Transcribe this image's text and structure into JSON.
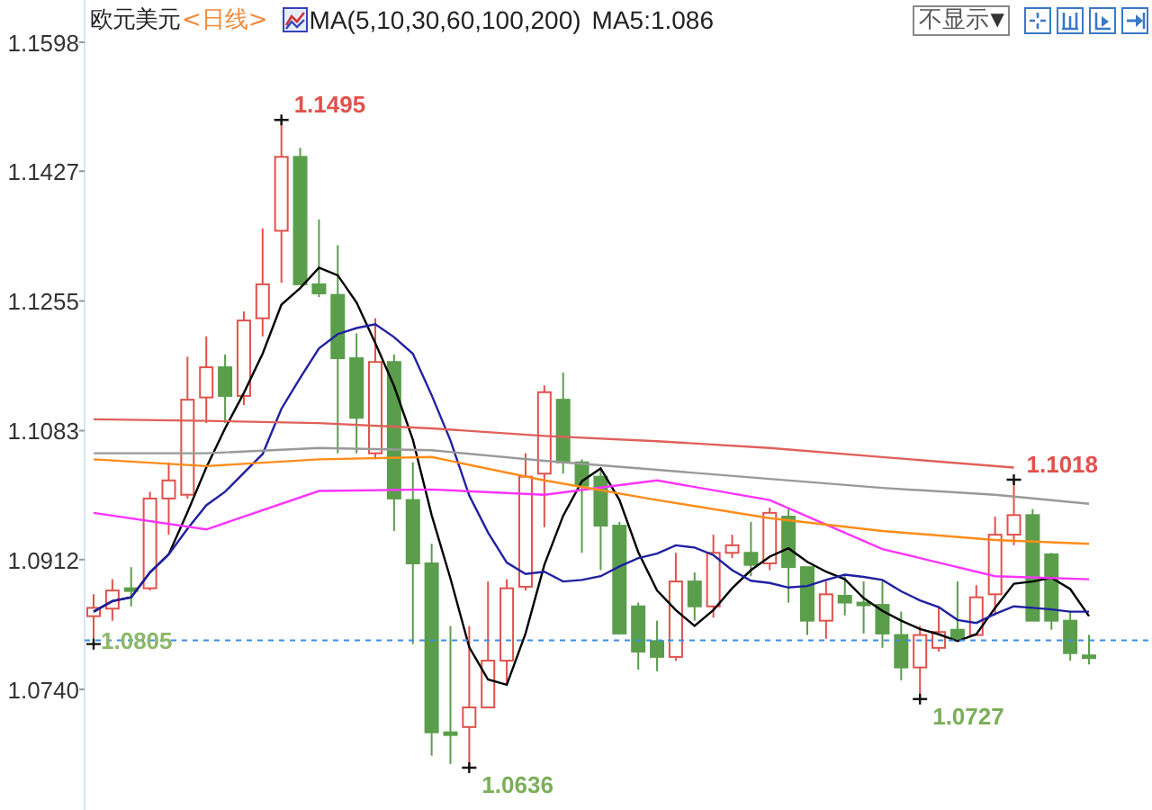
{
  "header": {
    "symbol": "欧元美元",
    "period": "<日线>",
    "indicator": "MA(5,10,30,60,100,200)",
    "indicator_value": "MA5:1.086",
    "dropdown": {
      "value": "不显示",
      "caret": "▼"
    }
  },
  "chart_data": {
    "type": "candlestick",
    "ylim": [
      1.058,
      1.1654
    ],
    "categories": [
      null,
      null,
      null,
      null,
      null,
      null,
      null,
      null,
      null,
      null,
      null,
      null,
      null,
      null,
      null,
      null,
      null,
      null,
      null,
      null,
      null,
      null,
      null,
      null,
      null,
      null,
      null,
      null,
      null,
      null,
      null,
      null,
      null,
      null,
      null,
      null,
      null,
      null,
      null,
      null,
      null,
      null,
      null,
      null,
      null,
      null,
      null,
      null,
      null,
      null,
      null,
      null,
      null,
      null
    ],
    "yticks": [
      {
        "value": 1.074,
        "label": "1.0740"
      },
      {
        "value": 1.0912,
        "label": "1.0912"
      },
      {
        "value": 1.1083,
        "label": "1.1083"
      },
      {
        "value": 1.1255,
        "label": "1.1255"
      },
      {
        "value": 1.1427,
        "label": "1.1427"
      },
      {
        "value": 1.1598,
        "label": "1.1598"
      }
    ],
    "ohlc": [
      [
        1.0837,
        1.0866,
        1.08,
        1.0848
      ],
      [
        1.0847,
        1.0886,
        1.0831,
        1.0871
      ],
      [
        1.0874,
        1.0902,
        1.085,
        1.0871
      ],
      [
        1.0874,
        1.1002,
        1.0871,
        1.0993
      ],
      [
        1.0993,
        1.1041,
        1.0945,
        1.1017
      ],
      [
        1.0998,
        1.1181,
        1.0993,
        1.1124
      ],
      [
        1.1127,
        1.1208,
        1.1093,
        1.1167
      ],
      [
        1.1167,
        1.1184,
        1.1093,
        1.1129
      ],
      [
        1.1129,
        1.1241,
        1.1117,
        1.1229
      ],
      [
        1.1232,
        1.1351,
        1.1208,
        1.1277
      ],
      [
        1.1348,
        1.1495,
        1.1279,
        1.1446
      ],
      [
        1.1446,
        1.1458,
        1.1277,
        1.1277
      ],
      [
        1.1277,
        1.1363,
        1.126,
        1.1265
      ],
      [
        1.1263,
        1.1329,
        1.1053,
        1.1179
      ],
      [
        1.1179,
        1.1212,
        1.1053,
        1.11
      ],
      [
        1.1053,
        1.1232,
        1.1045,
        1.1174
      ],
      [
        1.1174,
        1.1184,
        1.095,
        1.0993
      ],
      [
        1.0991,
        1.1041,
        1.08,
        1.0907
      ],
      [
        1.0907,
        1.0933,
        1.0652,
        1.0683
      ],
      [
        1.0683,
        1.0824,
        1.0641,
        1.068
      ],
      [
        1.069,
        1.0824,
        1.0636,
        1.0716
      ],
      [
        1.0716,
        1.0883,
        1.0716,
        1.0778
      ],
      [
        1.0778,
        1.0886,
        1.0747,
        1.0874
      ],
      [
        1.0876,
        1.1053,
        1.0871,
        1.1022
      ],
      [
        1.1026,
        1.1143,
        1.0955,
        1.1134
      ],
      [
        1.1124,
        1.116,
        1.1026,
        1.1041
      ],
      [
        1.1041,
        1.1045,
        1.0921,
        1.101
      ],
      [
        1.1022,
        1.1034,
        1.0898,
        1.0957
      ],
      [
        1.0957,
        1.0962,
        1.0814,
        1.0814
      ],
      [
        1.085,
        1.0855,
        1.0766,
        1.079
      ],
      [
        1.0804,
        1.0831,
        1.0764,
        1.0783
      ],
      [
        1.0783,
        1.0921,
        1.0778,
        1.0883
      ],
      [
        1.0883,
        1.0895,
        1.0831,
        1.085
      ],
      [
        1.085,
        1.0945,
        1.0835,
        1.0921
      ],
      [
        1.0921,
        1.0945,
        1.0914,
        1.0931
      ],
      [
        1.0921,
        1.0962,
        1.089,
        1.0905
      ],
      [
        1.0907,
        1.0981,
        1.0898,
        1.0974
      ],
      [
        1.0969,
        1.0981,
        1.0855,
        1.0902
      ],
      [
        1.0902,
        1.0902,
        1.0812,
        1.0831
      ],
      [
        1.0831,
        1.0883,
        1.0807,
        1.0866
      ],
      [
        1.0864,
        1.089,
        1.0838,
        1.0855
      ],
      [
        1.0855,
        1.0883,
        1.0814,
        1.0852
      ],
      [
        1.0852,
        1.0883,
        1.0795,
        1.0814
      ],
      [
        1.0812,
        1.0843,
        1.0752,
        1.0769
      ],
      [
        1.0769,
        1.0824,
        1.0727,
        1.0812
      ],
      [
        1.0795,
        1.085,
        1.079,
        1.0816
      ],
      [
        1.0819,
        1.0883,
        1.0804,
        1.0807
      ],
      [
        1.0812,
        1.0878,
        1.0812,
        1.0862
      ],
      [
        1.0866,
        1.0969,
        1.0838,
        1.0945
      ],
      [
        1.0945,
        1.1018,
        1.0931,
        1.0971
      ],
      [
        1.0971,
        1.0979,
        1.0831,
        1.0831
      ],
      [
        1.0919,
        1.0921,
        1.0819,
        1.0831
      ],
      [
        1.0831,
        1.0843,
        1.0778,
        1.0788
      ],
      [
        1.0785,
        1.0812,
        1.0773,
        1.0783
      ]
    ],
    "series": [
      {
        "type": "line",
        "color": "#000000",
        "values": [
          1.0843,
          1.0857,
          1.0862,
          1.0895,
          1.0919,
          1.0975,
          1.1034,
          1.1086,
          1.1133,
          1.1185,
          1.125,
          1.1272,
          1.1299,
          1.1289,
          1.1253,
          1.1199,
          1.1142,
          1.1071,
          1.0971,
          1.0887,
          1.0796,
          1.0753,
          1.0746,
          1.0814,
          1.0905,
          1.097,
          1.1016,
          1.1033,
          1.0991,
          1.0922,
          1.0871,
          1.0845,
          1.0824,
          1.0845,
          1.0874,
          1.0898,
          1.0916,
          1.0927,
          1.0909,
          1.0896,
          1.0886,
          1.0861,
          1.0844,
          1.0831,
          1.082,
          1.0813,
          1.0804,
          1.0813,
          1.0848,
          1.088,
          1.0883,
          1.0888,
          1.0873,
          1.0837
        ]
      },
      {
        "type": "line",
        "color": "#2020a0",
        "values": [
          1.0843,
          1.0857,
          1.0862,
          1.0895,
          1.0919,
          1.0953,
          1.0984,
          1.1002,
          1.1027,
          1.1052,
          1.1112,
          1.1153,
          1.1192,
          1.1211,
          1.1219,
          1.1224,
          1.1207,
          1.1185,
          1.113,
          1.107,
          1.0997,
          1.0948,
          1.0908,
          1.0893,
          1.0896,
          1.0883,
          1.0885,
          1.089,
          1.0903,
          1.0914,
          1.092,
          1.0931,
          1.0928,
          1.0918,
          1.0898,
          1.0884,
          1.0881,
          1.0875,
          1.0877,
          1.0885,
          1.0892,
          1.0889,
          1.0885,
          1.087,
          1.0858,
          1.0849,
          1.0832,
          1.0828,
          1.084,
          1.085,
          1.0848,
          1.0846,
          1.0843,
          1.0843
        ]
      },
      {
        "type": "line",
        "color": "#ff33ff",
        "values": [
          1.0974,
          null,
          null,
          null,
          null,
          null,
          1.0952,
          null,
          null,
          null,
          null,
          null,
          1.1003,
          null,
          null,
          null,
          null,
          null,
          1.1005,
          null,
          null,
          null,
          null,
          null,
          1.0998,
          null,
          null,
          null,
          null,
          null,
          1.1017,
          null,
          null,
          null,
          null,
          null,
          1.0991,
          null,
          null,
          null,
          null,
          null,
          1.0926,
          null,
          null,
          null,
          null,
          null,
          1.089,
          null,
          null,
          null,
          null,
          1.0886
        ]
      },
      {
        "type": "line",
        "color": "#ff8c1a",
        "values": [
          1.1045,
          null,
          null,
          null,
          null,
          null,
          1.1036,
          null,
          null,
          null,
          null,
          null,
          1.1045,
          null,
          null,
          null,
          null,
          null,
          1.1048,
          null,
          null,
          null,
          null,
          null,
          1.1017,
          null,
          null,
          null,
          null,
          null,
          1.0991,
          null,
          null,
          null,
          null,
          null,
          1.0967,
          null,
          null,
          null,
          null,
          null,
          1.095,
          null,
          null,
          null,
          null,
          null,
          1.0938,
          null,
          null,
          null,
          null,
          1.0933
        ]
      },
      {
        "type": "line",
        "color": "#999999",
        "values": [
          1.1053,
          null,
          null,
          null,
          null,
          null,
          1.1053,
          null,
          null,
          null,
          null,
          null,
          1.106,
          null,
          null,
          null,
          null,
          null,
          1.1057,
          null,
          null,
          null,
          null,
          null,
          1.1043,
          null,
          null,
          null,
          null,
          null,
          1.1031,
          null,
          null,
          null,
          null,
          null,
          1.1019,
          null,
          null,
          null,
          null,
          null,
          1.1007,
          null,
          null,
          null,
          null,
          null,
          1.0998,
          null,
          null,
          null,
          null,
          1.0986
        ]
      },
      {
        "type": "line",
        "color": "#e0605a",
        "values": [
          1.1098,
          null,
          null,
          null,
          null,
          null,
          1.1096,
          null,
          null,
          null,
          null,
          null,
          1.1093,
          null,
          null,
          null,
          null,
          null,
          1.1086,
          null,
          null,
          null,
          null,
          null,
          1.1076,
          null,
          null,
          null,
          null,
          null,
          1.1069,
          null,
          null,
          null,
          null,
          null,
          1.106,
          null,
          null,
          null,
          null,
          null,
          1.1048,
          null,
          null,
          null,
          null,
          null,
          null,
          1.1034,
          null,
          null,
          null,
          null
        ]
      }
    ],
    "annotations": [
      "1.1495",
      "1.0636",
      "1.0727",
      "1.1018"
    ],
    "ref_lines": [
      {
        "axis": "y",
        "value": 1.0805,
        "label": "1.0805"
      }
    ]
  }
}
